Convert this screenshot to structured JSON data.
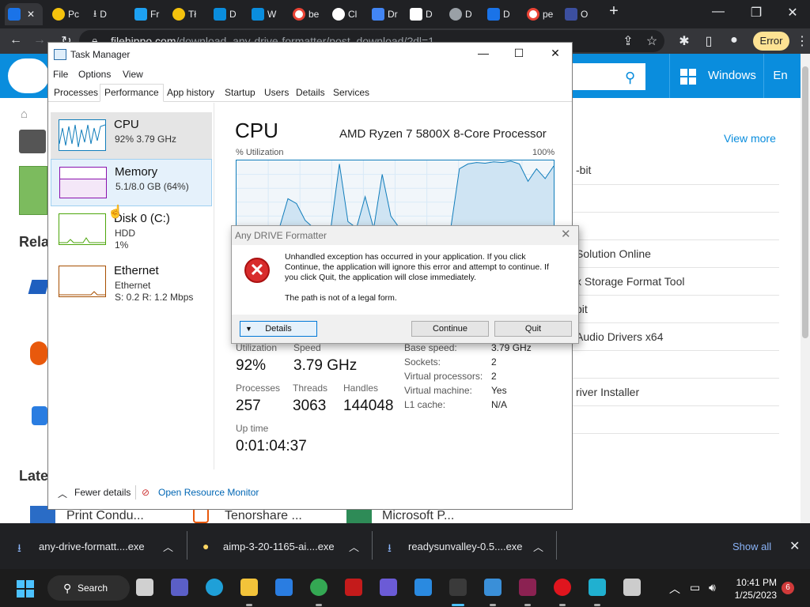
{
  "browser": {
    "tabs": [
      {
        "label": "",
        "color": "#1a73e8"
      },
      {
        "label": "Pc",
        "color": "#f4c20d"
      },
      {
        "label": "D",
        "color": "#e8eaed"
      },
      {
        "label": "Fr",
        "color": "#1da1f2"
      },
      {
        "label": "Tł",
        "color": "#f4c20d"
      },
      {
        "label": "D",
        "color": "#0a8ddd"
      },
      {
        "label": "W",
        "color": "#0a8ddd"
      },
      {
        "label": "be",
        "color": "#ea4335"
      },
      {
        "label": "Cl",
        "color": "#ffffff"
      },
      {
        "label": "Dr",
        "color": "#4285f4"
      },
      {
        "label": "D",
        "color": "#ffffff"
      },
      {
        "label": "D",
        "color": "#9aa0a6"
      },
      {
        "label": "D",
        "color": "#1a73e8"
      },
      {
        "label": "pe",
        "color": "#ea4335"
      },
      {
        "label": "O",
        "color": "#3c4fa0"
      }
    ],
    "url_host": "filehippo.com",
    "url_path": "/download_any-drive-formatter/post_download/?dl=1",
    "error_chip": "Error"
  },
  "site": {
    "header_windows": "Windows",
    "header_lang": "En",
    "view_more": "View more",
    "crumb_home": "⌂",
    "related_heading": "Rela",
    "latest_heading": "Late",
    "list": [
      "-bit",
      "",
      "",
      "Solution Online",
      "x Storage Format Tool",
      "bit",
      "Audio Drivers x64",
      "",
      "river Installer",
      ""
    ],
    "latest": [
      "Print Condu...",
      "Tenorshare ...",
      "Microsoft P..."
    ]
  },
  "taskmanager": {
    "title": "Task Manager",
    "menu": [
      "File",
      "Options",
      "View"
    ],
    "tabs": [
      "Processes",
      "Performance",
      "App history",
      "Startup",
      "Users",
      "Details",
      "Services"
    ],
    "sidebar": [
      {
        "name": "CPU",
        "sub1": "92% 3.79 GHz",
        "sub2": "",
        "color": "#117dbb"
      },
      {
        "name": "Memory",
        "sub1": "5.1/8.0 GB (64%)",
        "sub2": "",
        "color": "#8b12ae"
      },
      {
        "name": "Disk 0 (C:)",
        "sub1": "HDD",
        "sub2": "1%",
        "color": "#4da60c"
      },
      {
        "name": "Ethernet",
        "sub1": "Ethernet",
        "sub2": "S: 0.2  R: 1.2 Mbps",
        "color": "#a74f01"
      }
    ],
    "main_title": "CPU",
    "cpu_name": "AMD Ryzen 7 5800X 8-Core Processor",
    "util_label": "% Utilization",
    "util_max": "100%",
    "utilization_history": [
      2,
      3,
      2,
      4,
      2,
      3,
      45,
      38,
      14,
      3,
      2,
      2,
      95,
      12,
      3,
      48,
      2,
      80,
      20,
      3,
      2,
      4,
      5,
      3,
      4,
      3,
      88,
      95,
      97,
      96,
      98,
      97,
      99,
      95,
      70,
      88,
      74,
      92
    ],
    "stats": {
      "utilization_label": "Utilization",
      "utilization": "92%",
      "speed_label": "Speed",
      "speed": "3.79 GHz",
      "processes_label": "Processes",
      "processes": "257",
      "threads_label": "Threads",
      "threads": "3063",
      "handles_label": "Handles",
      "handles": "144048",
      "uptime_label": "Up time",
      "uptime": "0:01:04:37"
    },
    "details": [
      {
        "k": "Base speed:",
        "v": "3.79 GHz"
      },
      {
        "k": "Sockets:",
        "v": "2"
      },
      {
        "k": "Virtual processors:",
        "v": "2"
      },
      {
        "k": "Virtual machine:",
        "v": "Yes"
      },
      {
        "k": "L1 cache:",
        "v": "N/A"
      }
    ],
    "fewer_details": "Fewer details",
    "open_resource_monitor": "Open Resource Monitor"
  },
  "dialog": {
    "title": "Any DRIVE Formatter",
    "message": "Unhandled exception has occurred in your application. If you click Continue, the application will ignore this error and attempt to continue. If you click Quit, the application will close immediately.",
    "detail": "The path is not of a legal form.",
    "details_button": "Details",
    "continue_button": "Continue",
    "quit_button": "Quit"
  },
  "downloads": {
    "items": [
      "any-drive-formatt....exe",
      "aimp-3-20-1165-ai....exe",
      "readysunvalley-0.5....exe"
    ],
    "show_all": "Show all"
  },
  "taskbar": {
    "search": "Search",
    "time": "10:41 PM",
    "date": "1/25/2023",
    "notifications": "6",
    "apps": [
      {
        "name": "task-view",
        "color": "#d0d0d0"
      },
      {
        "name": "meet",
        "color": "#5b5fc7"
      },
      {
        "name": "edge",
        "color": "#1fa0d8"
      },
      {
        "name": "explorer",
        "color": "#f2c33a"
      },
      {
        "name": "store",
        "color": "#2a7de1"
      },
      {
        "name": "chrome",
        "color": "#34a853"
      },
      {
        "name": "app-red",
        "color": "#c41b1b"
      },
      {
        "name": "app-p",
        "color": "#6b5bd6"
      },
      {
        "name": "photos",
        "color": "#2a8ae0"
      },
      {
        "name": "settings",
        "color": "#888888"
      },
      {
        "name": "task-manager",
        "color": "#3a8fd8"
      },
      {
        "name": "winrar",
        "color": "#8b2252"
      },
      {
        "name": "opera",
        "color": "#e0151e"
      },
      {
        "name": "app-cyan",
        "color": "#20b0d0"
      },
      {
        "name": "usb",
        "color": "#cccccc"
      }
    ]
  }
}
